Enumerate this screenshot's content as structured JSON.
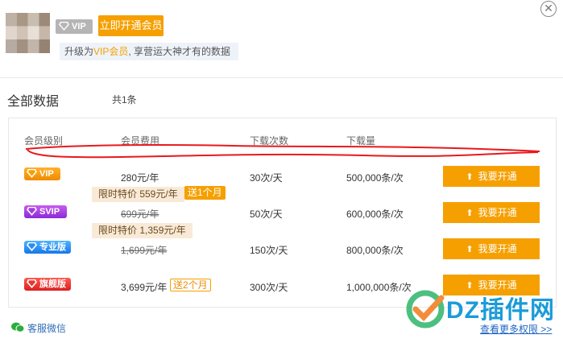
{
  "header": {
    "vip_tag": "VIP",
    "open_button": "立即开通会员",
    "promo_prefix": "升级为",
    "promo_highlight": "VIP会员",
    "promo_suffix": ", 享营运大神才有的数据"
  },
  "section": {
    "title": "全部数据",
    "count": "共1条"
  },
  "table": {
    "headers": [
      "会员级别",
      "会员费用",
      "下载次数",
      "下载量"
    ],
    "rows": [
      {
        "level": "VIP",
        "price": "280元/年",
        "downloads": "30次/天",
        "volume": "500,000条/次",
        "action": "我要开通"
      },
      {
        "level": "SVIP",
        "sale": "限时特价 559元/年",
        "gift": "送1个月",
        "price": "699元/年",
        "downloads": "50次/天",
        "volume": "600,000条/次",
        "action": "我要开通"
      },
      {
        "level": "专业版",
        "sale": "限时特价 1,359元/年",
        "price": "1,699元/年",
        "downloads": "150次/天",
        "volume": "800,000条/次",
        "action": "我要开通"
      },
      {
        "level": "旗舰版",
        "price": "3,699元/年",
        "gift": "送2个月",
        "downloads": "300次/天",
        "volume": "1,000,000条/次",
        "action": "我要开通"
      }
    ]
  },
  "footer": {
    "wechat": "客服微信",
    "more": "查看更多权限 >>"
  },
  "watermark": {
    "text": "DZ插件网"
  },
  "colors": {
    "accent": "#f5a000",
    "link": "#1f66c4",
    "annotation": "#e8191c"
  }
}
